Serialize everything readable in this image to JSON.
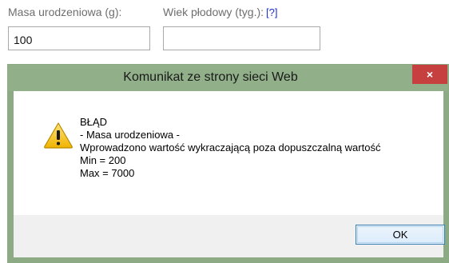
{
  "form": {
    "mass_label": "Masa urodzeniowa (g):",
    "age_label": "Wiek płodowy (tyg.):",
    "age_help_link": "[?]",
    "mass_value": "100",
    "age_value": ""
  },
  "dialog": {
    "title": "Komunikat ze strony sieci Web",
    "close_glyph": "×",
    "icon": "warning-icon",
    "message_lines": [
      "BŁĄD",
      "- Masa urodzeniowa -",
      "Wprowadzono wartość wykraczającą poza dopuszczalną wartość",
      "Min = 200",
      "Max = 7000"
    ],
    "ok_label": "OK"
  },
  "colors": {
    "dialog_frame": "#91b089",
    "close_button": "#c74040",
    "link": "#1b2fcf",
    "warning_yellow": "#f5c816"
  }
}
